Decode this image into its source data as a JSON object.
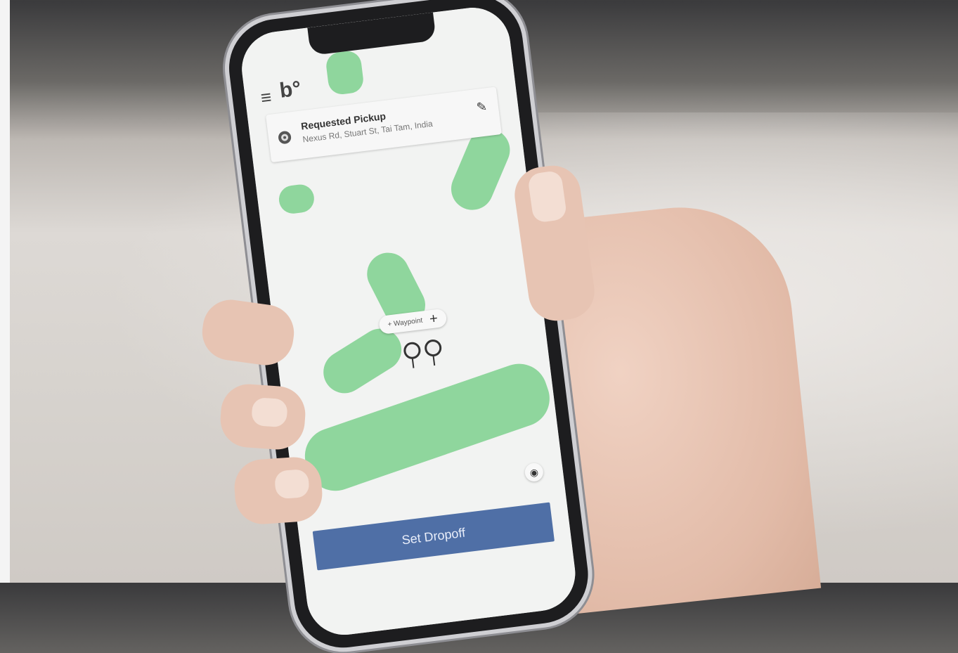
{
  "app": {
    "logo_text": "b°",
    "menu_icon": "hamburger-menu-icon"
  },
  "pickup_card": {
    "title": "Requested Pickup",
    "address": "Nexus Rd, Stuart St, Tai Tam, India",
    "edit_icon": "pencil-icon"
  },
  "map": {
    "waypoint_label": "+ Waypoint",
    "waypoint_add_icon": "plus-icon",
    "locate_icon": "locate-icon"
  },
  "cta": {
    "label": "Set Dropoff",
    "color": "#4f6fa6"
  }
}
